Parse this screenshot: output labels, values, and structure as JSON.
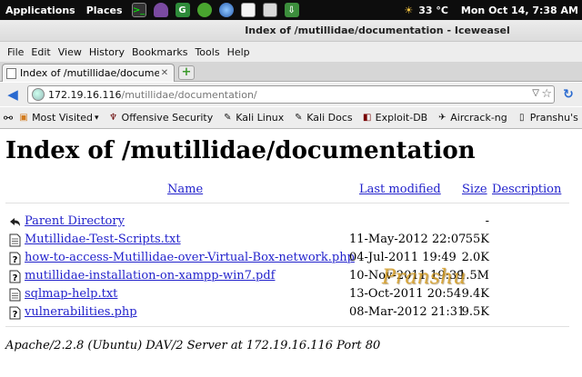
{
  "panel": {
    "applications_label": "Applications",
    "places_label": "Places",
    "weather": "33 °C",
    "clock": "Mon Oct 14,  7:38 AM"
  },
  "window": {
    "title": "Index of /mutillidae/documentation - Iceweasel"
  },
  "menubar": {
    "items": [
      "File",
      "Edit",
      "View",
      "History",
      "Bookmarks",
      "Tools",
      "Help"
    ]
  },
  "tab": {
    "label": "Index of /mutillidae/documenta..."
  },
  "nav": {
    "url_host": "172.19.16.116",
    "url_path": "/mutillidae/documentation/"
  },
  "bookmarks": [
    "Most Visited",
    "Offensive Security",
    "Kali Linux",
    "Kali Docs",
    "Exploit-DB",
    "Aircrack-ng",
    "Pranshu's Resear"
  ],
  "page": {
    "heading": "Index of /mutillidae/documentation",
    "columns": {
      "name": "Name",
      "last_modified": "Last modified",
      "size": "Size",
      "description": "Description"
    },
    "parent": {
      "name": "Parent Directory",
      "size": "-"
    },
    "files": [
      {
        "name": "Mutillidae-Test-Scripts.txt",
        "date": "11-May-2012 22:07",
        "size": "55K",
        "icon": "text-file-icon"
      },
      {
        "name": "how-to-access-Mutillidae-over-Virtual-Box-network.php",
        "date": "04-Jul-2011 19:49",
        "size": "2.0K",
        "icon": "unknown-file-icon"
      },
      {
        "name": "mutillidae-installation-on-xampp-win7.pdf",
        "date": "10-Nov-2011 19:39",
        "size": "1.5M",
        "icon": "unknown-file-icon"
      },
      {
        "name": "sqlmap-help.txt",
        "date": "13-Oct-2011 20:54",
        "size": "9.4K",
        "icon": "text-file-icon"
      },
      {
        "name": "vulnerabilities.php",
        "date": "08-Mar-2012 21:31",
        "size": "9.5K",
        "icon": "unknown-file-icon"
      }
    ],
    "footer": "Apache/2.2.8 (Ubuntu) DAV/2 Server at 172.19.16.116 Port 80",
    "watermark": "Pranshu"
  }
}
